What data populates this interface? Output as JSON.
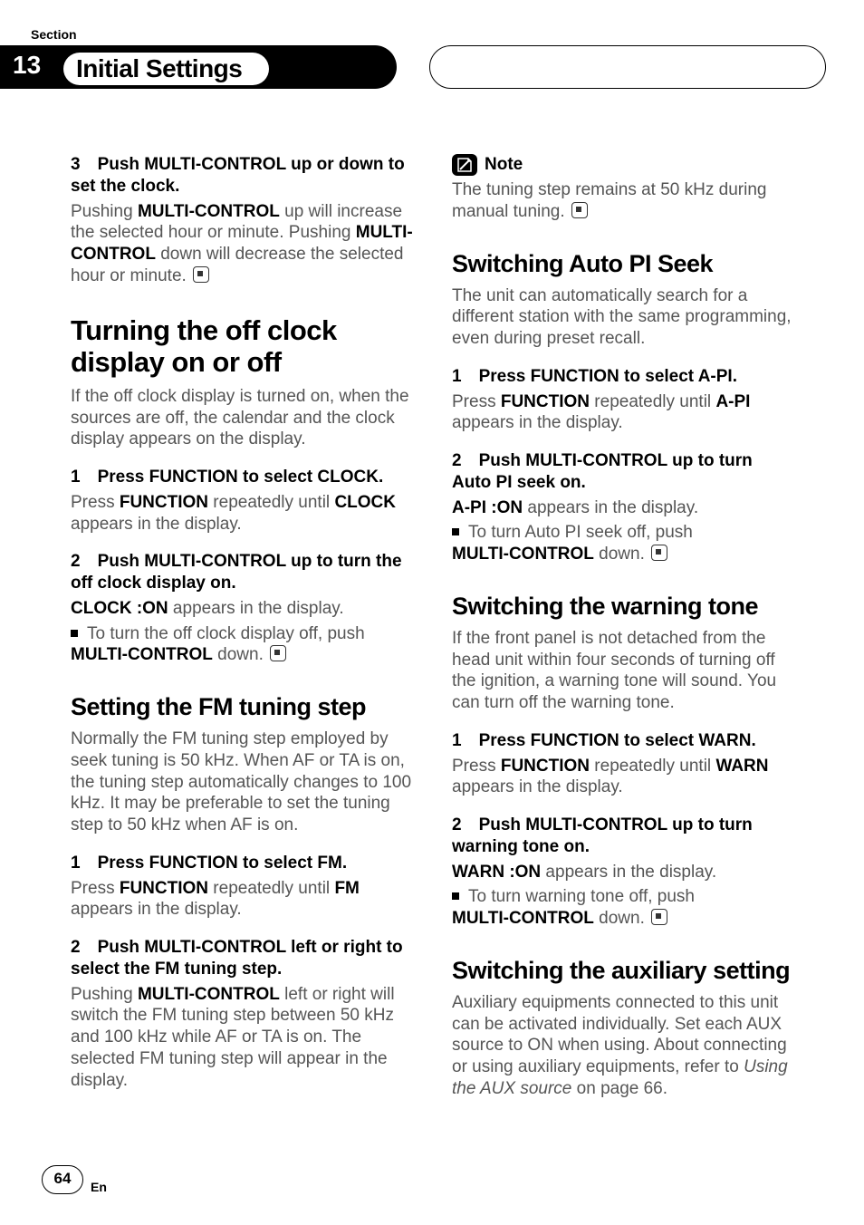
{
  "header": {
    "section_label": "Section",
    "section_number": "13",
    "chapter_title": "Initial Settings"
  },
  "left": {
    "step3_head": "3 Push MULTI-CONTROL up or down to set the clock.",
    "step3_p1a": "Pushing ",
    "step3_p1_mc": "MULTI-CONTROL",
    "step3_p1b": " up will increase the selected hour or minute. Pushing ",
    "step3_p1c": " down will decrease the selected hour or minute.",
    "h_offclock": "Turning the off clock display on or off",
    "offclock_intro": "If the off clock display is turned on, when the sources are off, the calendar and the clock display appears on the display.",
    "oc_s1_head": "1 Press FUNCTION to select CLOCK.",
    "oc_s1_a": "Press ",
    "oc_s1_func": "FUNCTION",
    "oc_s1_b": " repeatedly until ",
    "oc_s1_clock": "CLOCK",
    "oc_s1_c": " appears in the display.",
    "oc_s2_head": "2 Push MULTI-CONTROL up to turn the off clock display on.",
    "oc_s2_on": "CLOCK :ON",
    "oc_s2_tail": " appears in the display.",
    "oc_s2_bullet": "To turn the off clock display off, push",
    "oc_s2_mc": "MULTI-CONTROL",
    "oc_s2_down": " down.",
    "h_fm": "Setting the FM tuning step",
    "fm_intro": "Normally the FM tuning step employed by seek tuning is 50 kHz. When AF or TA is on, the tuning step automatically changes to 100 kHz. It may be preferable to set the tuning step to 50 kHz when AF is on.",
    "fm_s1_head": "1 Press FUNCTION to select FM.",
    "fm_s1_a": "Press ",
    "fm_s1_func": "FUNCTION",
    "fm_s1_b": " repeatedly until ",
    "fm_s1_fm": "FM",
    "fm_s1_c": " appears in the display.",
    "fm_s2_head": "2 Push MULTI-CONTROL left or right to select the FM tuning step.",
    "fm_s2_a": "Pushing ",
    "fm_s2_mc": "MULTI-CONTROL",
    "fm_s2_b": " left or right will switch the FM tuning step between 50 kHz and 100 kHz while AF or TA is on. The selected FM tuning step will appear in the display."
  },
  "right": {
    "note_label": "Note",
    "note_text": "The tuning step remains at 50 kHz during manual tuning.",
    "h_autopi": "Switching Auto PI Seek",
    "autopi_intro": "The unit can automatically search for a different station with the same programming, even during preset recall.",
    "ap_s1_head": "1 Press FUNCTION to select A-PI.",
    "ap_s1_a": "Press ",
    "ap_s1_func": "FUNCTION",
    "ap_s1_b": " repeatedly until ",
    "ap_s1_api": "A-PI",
    "ap_s1_c": " appears in the display.",
    "ap_s2_head": "2 Push MULTI-CONTROL up to turn Auto PI seek on.",
    "ap_s2_on": "A-PI :ON",
    "ap_s2_tail": " appears in the display.",
    "ap_s2_bullet": "To turn Auto PI seek off, push",
    "ap_s2_mc": "MULTI-CONTROL",
    "ap_s2_down": " down.",
    "h_warn": "Switching the warning tone",
    "warn_intro": "If the front panel is not detached from the head unit within four seconds of turning off the ignition, a warning tone will sound. You can turn off the warning tone.",
    "wn_s1_head": "1 Press FUNCTION to select WARN.",
    "wn_s1_a": "Press ",
    "wn_s1_func": "FUNCTION",
    "wn_s1_b": " repeatedly until ",
    "wn_s1_warn": "WARN",
    "wn_s1_c": " appears in the display.",
    "wn_s2_head": "2 Push MULTI-CONTROL up to turn warning tone on.",
    "wn_s2_on": "WARN :ON",
    "wn_s2_tail": " appears in the display.",
    "wn_s2_bullet": "To turn warning tone off, push",
    "wn_s2_mc": "MULTI-CONTROL",
    "wn_s2_down": " down.",
    "h_aux": "Switching the auxiliary setting",
    "aux_intro_a": "Auxiliary equipments connected to this unit can be activated individually. Set each AUX source to ON when using. About connecting or using auxiliary equipments, refer to ",
    "aux_intro_it": "Using the AUX source",
    "aux_intro_b": " on page 66."
  },
  "footer": {
    "page_number": "64",
    "lang": "En"
  }
}
